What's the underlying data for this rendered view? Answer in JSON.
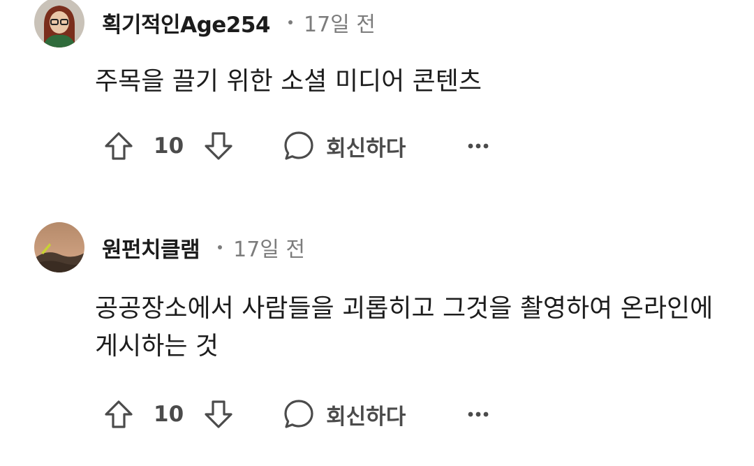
{
  "comments": [
    {
      "username": "획기적인Age254",
      "time": "17일 전",
      "body": "주목을 끌기 위한 소셜 미디어 콘텐츠",
      "votes": "10",
      "reply_label": "회신하다"
    },
    {
      "username": "원펀치클램",
      "time": "17일 전",
      "body": "공공장소에서 사람들을 괴롭히고 그것을 촬영하여 온라인에 게시하는 것",
      "votes": "10",
      "reply_label": "회신하다"
    }
  ],
  "icons": {
    "upvote": "arrow-up-outline-icon",
    "downvote": "arrow-down-outline-icon",
    "reply": "speech-bubble-icon",
    "more": "ellipsis-icon"
  },
  "colors": {
    "text": "#1c1c1c",
    "meta": "#7c7c7c",
    "action": "#4b4b4b"
  }
}
